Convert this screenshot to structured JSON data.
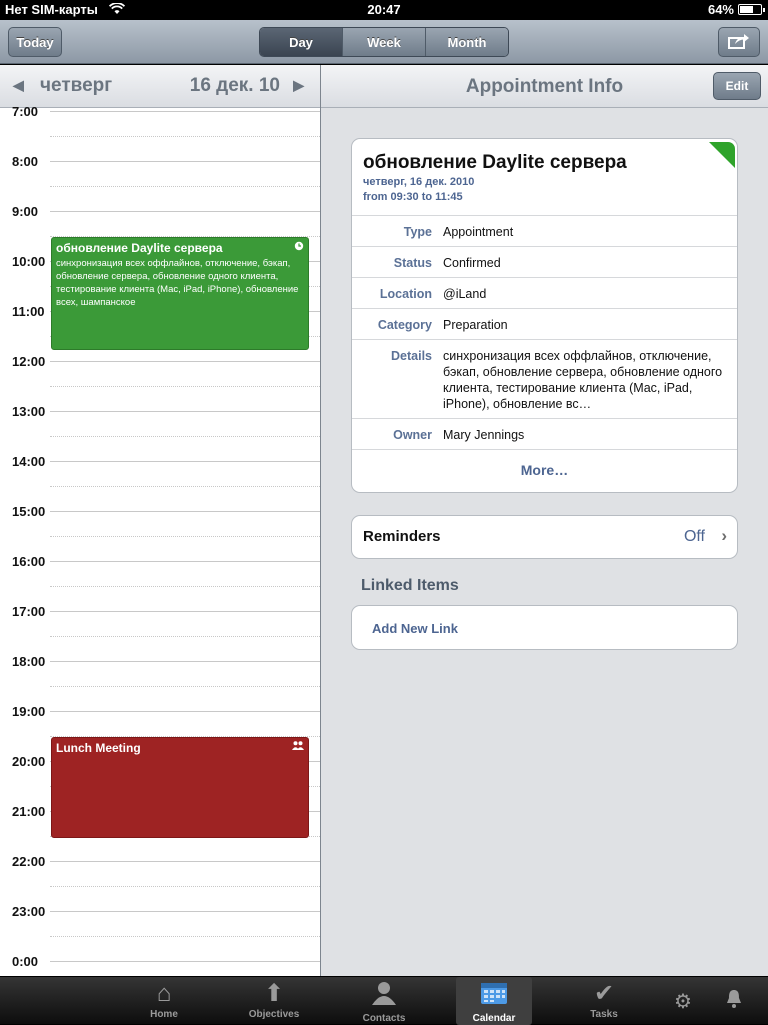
{
  "status_bar": {
    "carrier": "Нет SIM-карты",
    "time": "20:47",
    "battery": "64%",
    "battery_level": 0.64
  },
  "toolbar": {
    "today_label": "Today",
    "segments": [
      "Day",
      "Week",
      "Month"
    ],
    "selected_segment": "Day"
  },
  "day_header": {
    "weekday": "четверг",
    "date": "16 дек. 10"
  },
  "hours": [
    "7:00",
    "8:00",
    "9:00",
    "10:00",
    "11:00",
    "12:00",
    "13:00",
    "14:00",
    "15:00",
    "16:00",
    "17:00",
    "18:00",
    "19:00",
    "20:00",
    "21:00",
    "22:00",
    "23:00",
    "0:00"
  ],
  "events": [
    {
      "title": "обновление Daylite сервера",
      "description": "синхронизация всех оффлайнов, отключение, бэкап, обновление сервера, обновление одного клиента, тестирование клиента (Mac, iPad, iPhone), обновление всех, шампанское",
      "color": "#3b9a38",
      "icon": "clock-icon"
    },
    {
      "title": "Lunch Meeting",
      "description": "",
      "color": "#9e2323",
      "icon": "people-icon"
    }
  ],
  "appointment": {
    "header_title": "Appointment Info",
    "edit_label": "Edit",
    "title": "обновление Daylite сервера",
    "date_line": "четверг, 16 дек. 2010",
    "time_line": "from 09:30 to 11:45",
    "status_color": "#2fa32b",
    "fields": [
      {
        "key": "Type",
        "value": "Appointment"
      },
      {
        "key": "Status",
        "value": "Confirmed"
      },
      {
        "key": "Location",
        "value": "@iLand"
      },
      {
        "key": "Category",
        "value": "Preparation"
      },
      {
        "key": "Details",
        "value": "синхронизация всех оффлайнов, отключение, бэкап, обновление сервера, обновление одного клиента, тестирование клиента (Mac, iPad, iPhone), обновление вс…"
      },
      {
        "key": "Owner",
        "value": "Mary Jennings"
      }
    ],
    "more_label": "More…"
  },
  "reminders": {
    "label": "Reminders",
    "value": "Off"
  },
  "linked_items": {
    "header": "Linked Items",
    "add_label": "Add New Link"
  },
  "tabbar": {
    "tabs": [
      {
        "label": "Home",
        "icon": "home-icon"
      },
      {
        "label": "Objectives",
        "icon": "objectives-icon"
      },
      {
        "label": "Contacts",
        "icon": "contacts-icon"
      },
      {
        "label": "Calendar",
        "icon": "calendar-icon"
      },
      {
        "label": "Tasks",
        "icon": "tasks-icon"
      }
    ],
    "active": "Calendar"
  }
}
